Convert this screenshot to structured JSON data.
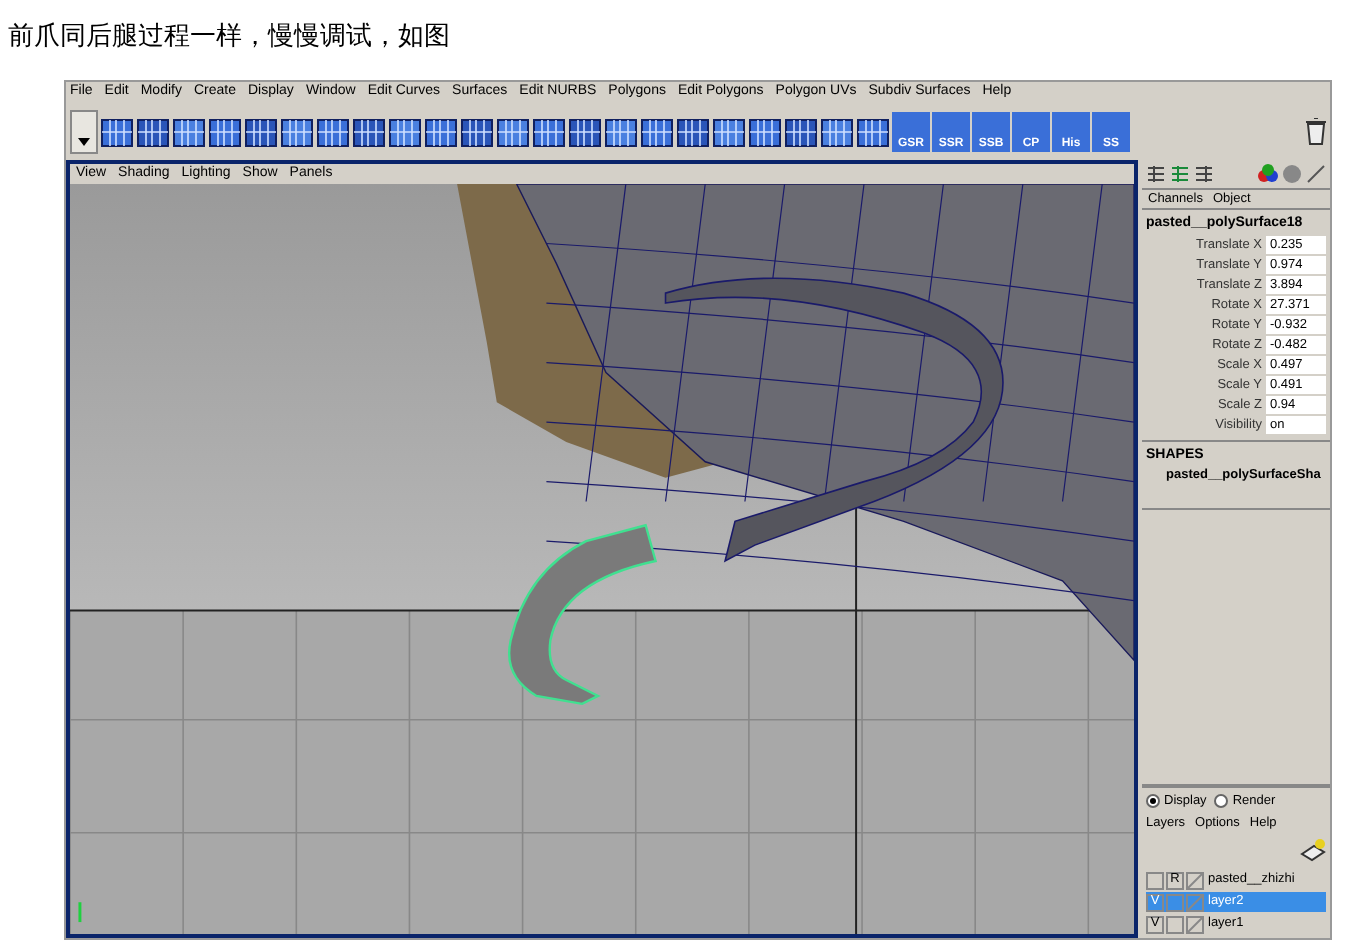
{
  "caption": "前爪同后腿过程一样，慢慢调试，如图",
  "menu_bar": [
    "File",
    "Edit",
    "Modify",
    "Create",
    "Display",
    "Window",
    "Edit Curves",
    "Surfaces",
    "Edit NURBS",
    "Polygons",
    "Edit Polygons",
    "Polygon UVs",
    "Subdiv Surfaces",
    "Help"
  ],
  "shelf_labels": [
    "GSR",
    "SSR",
    "SSB",
    "CP",
    "His",
    "SS"
  ],
  "viewport_menu": [
    "View",
    "Shading",
    "Lighting",
    "Show",
    "Panels"
  ],
  "channel_box": {
    "tabs": [
      "Channels",
      "Object"
    ],
    "object": "pasted__polySurface18",
    "attributes": [
      {
        "label": "Translate X",
        "value": "0.235"
      },
      {
        "label": "Translate Y",
        "value": "0.974"
      },
      {
        "label": "Translate Z",
        "value": "3.894"
      },
      {
        "label": "Rotate X",
        "value": "27.371"
      },
      {
        "label": "Rotate Y",
        "value": "-0.932"
      },
      {
        "label": "Rotate Z",
        "value": "-0.482"
      },
      {
        "label": "Scale X",
        "value": "0.497"
      },
      {
        "label": "Scale Y",
        "value": "0.491"
      },
      {
        "label": "Scale Z",
        "value": "0.94"
      },
      {
        "label": "Visibility",
        "value": "on"
      }
    ],
    "shapes_heading": "SHAPES",
    "shape": "pasted__polySurfaceSha"
  },
  "layer_editor": {
    "modes": [
      {
        "label": "Display",
        "selected": true
      },
      {
        "label": "Render",
        "selected": false
      }
    ],
    "menu": [
      "Layers",
      "Options",
      "Help"
    ],
    "layers": [
      {
        "reference": "R",
        "name": "pasted__zhizhi",
        "selected": false
      },
      {
        "visibility": "V",
        "name": "layer2",
        "selected": true
      },
      {
        "visibility": "V",
        "name": "layer1",
        "selected": false
      }
    ]
  }
}
